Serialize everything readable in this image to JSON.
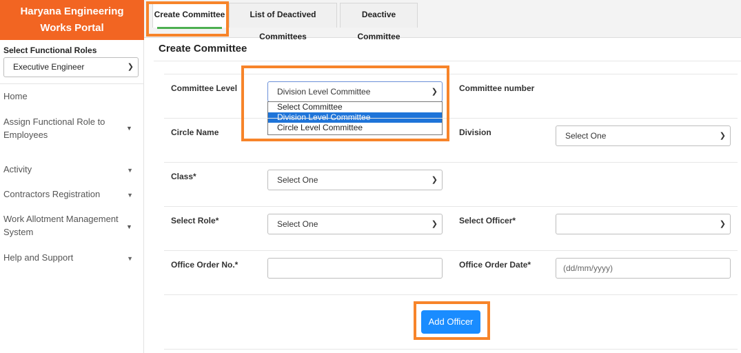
{
  "sidebar": {
    "brand_line1": "Haryana Engineering",
    "brand_line2": "Works Portal",
    "roles_label": "Select Functional Roles",
    "role_value": "Executive Engineer",
    "nav": [
      {
        "label": "Home"
      },
      {
        "label": "Assign Functional Role to Employees"
      },
      {
        "label": "Activity"
      },
      {
        "label": "Contractors Registration"
      },
      {
        "label": "Work Allotment Management System"
      },
      {
        "label": "Help and Support"
      }
    ]
  },
  "tabs": [
    {
      "label": "Create Committee"
    },
    {
      "label": "List of Deactived Committees"
    },
    {
      "label": "Deactive Committee"
    }
  ],
  "main": {
    "title": "Create Committee",
    "committee_level_label": "Committee Level",
    "committee_level_value": "Division Level Committee",
    "committee_level_options": [
      "Select Committee",
      "Division Level Committee",
      "Circle Level Committee"
    ],
    "committee_number_label": "Committee number",
    "circle_name_label": "Circle  Name",
    "division_label": "Division",
    "division_value": "Select One",
    "class_label": "Class*",
    "class_value": "Select One",
    "select_role_label": "Select Role*",
    "select_role_value": "Select One",
    "select_officer_label": "Select Officer*",
    "select_officer_value": "",
    "office_order_no_label": "Office Order No.*",
    "office_order_no_value": "",
    "office_order_date_label": "Office Order Date*",
    "office_order_date_placeholder": "(dd/mm/yyyy)",
    "add_officer_label": "Add Officer"
  },
  "colors": {
    "brand": "#f26522",
    "highlight": "#f7842a",
    "primary_button": "#1a8cff",
    "active_tab_underline": "#4caf50",
    "selected_option": "#1e74d9"
  }
}
